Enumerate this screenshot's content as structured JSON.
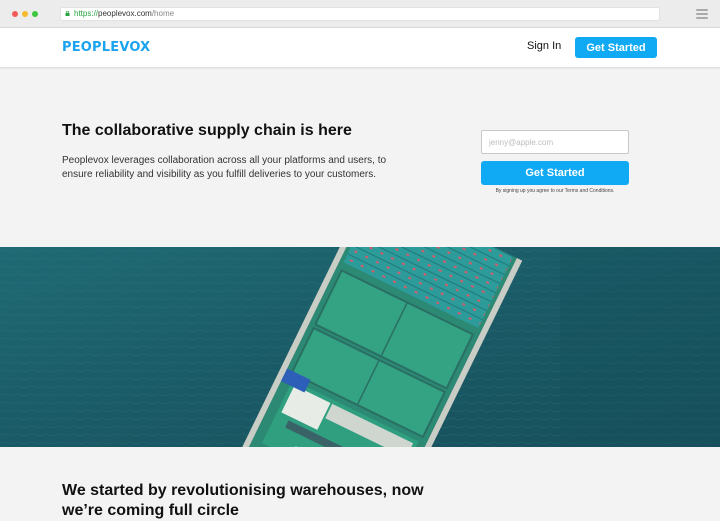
{
  "browser": {
    "url_protocol": "https://",
    "url_domain": "peoplevox.com",
    "url_path": "/home"
  },
  "header": {
    "logo": "PEOPLEVOX",
    "sign_in": "Sign In",
    "cta": "Get Started"
  },
  "hero": {
    "title": "The collaborative supply chain is here",
    "subtitle": "Peoplevox leverages collaboration across all your platforms and users, to ensure reliability and visibility as you fulfill deliveries to your customers.",
    "email_placeholder": "jenny@apple.com",
    "cta": "Get Started",
    "terms": "By signing up you agree to our Terms and Conditions."
  },
  "section2": {
    "title": "We started by revolutionising warehouses, now we’re coming full circle"
  },
  "colors": {
    "brand": "#1aa3ef",
    "button": "#10a9f4",
    "sea": "#1d5d68"
  }
}
